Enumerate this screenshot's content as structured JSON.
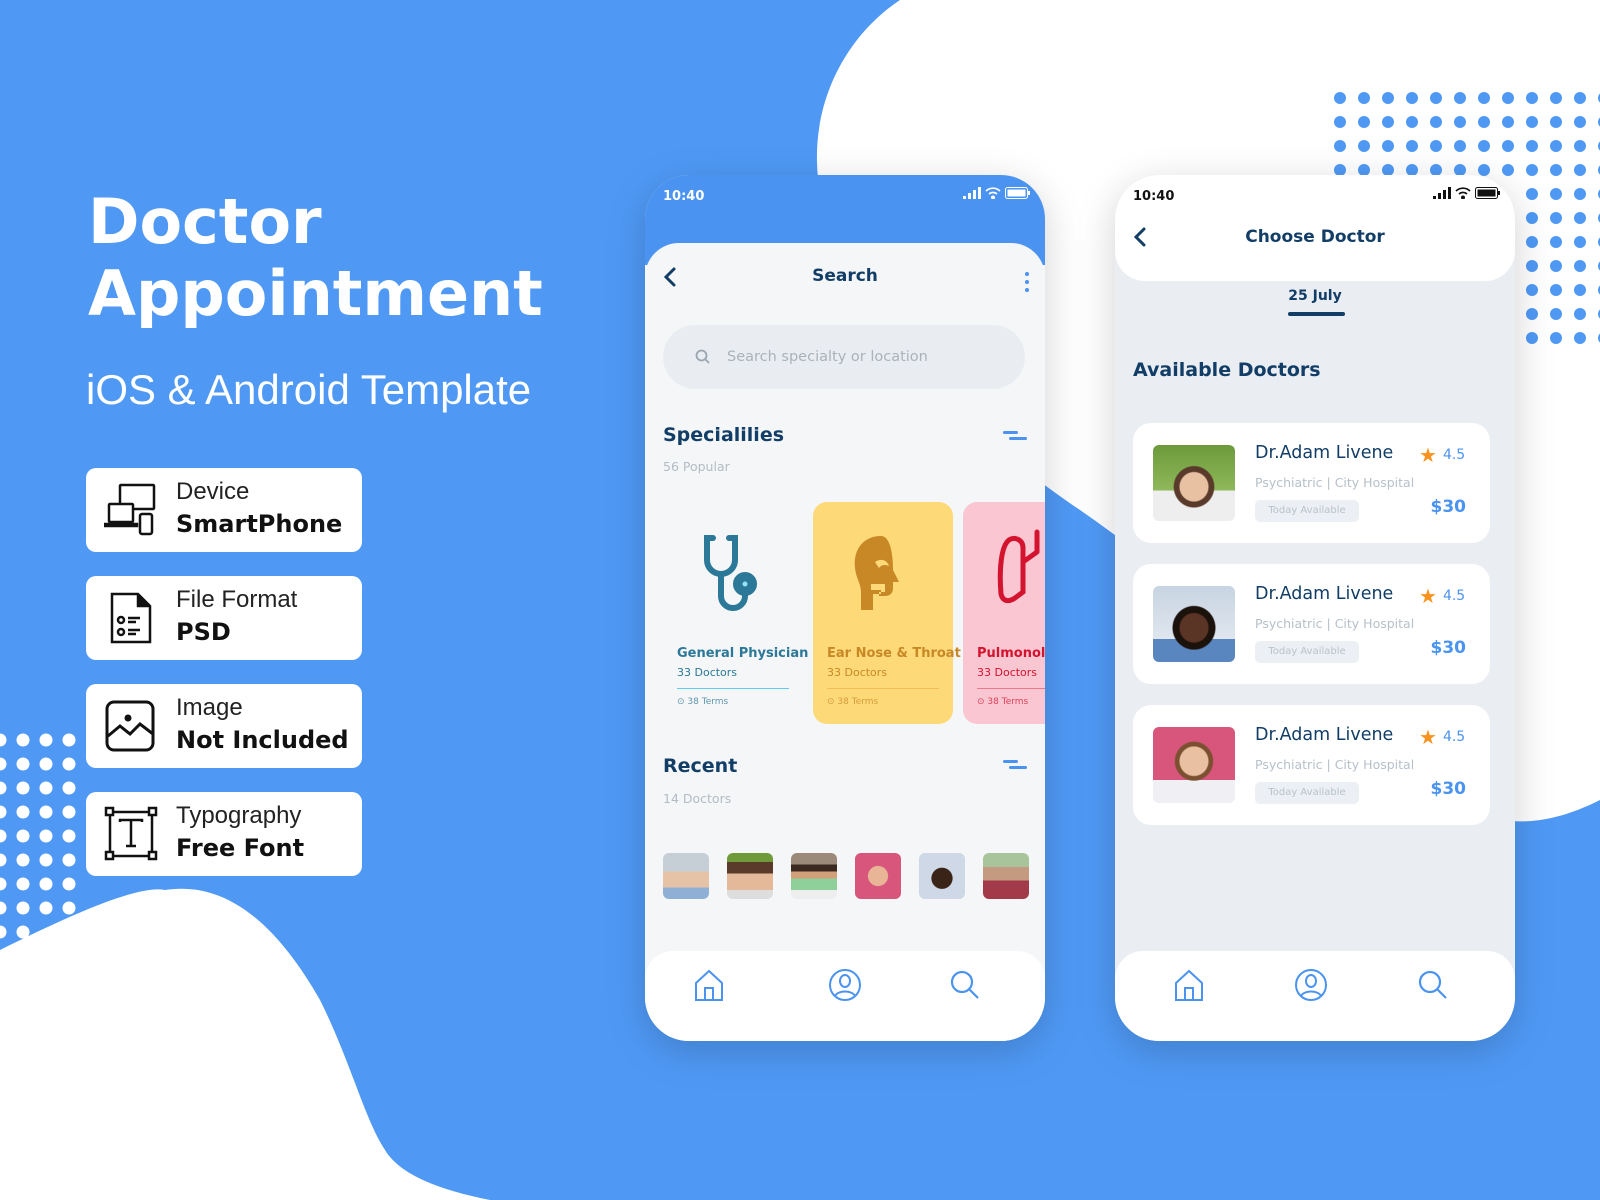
{
  "hero": {
    "title_line1": "Doctor",
    "title_line2": "Appointment",
    "subtitle": "iOS & Android Template"
  },
  "info_cards": [
    {
      "icon": "devices-icon",
      "label": "Device",
      "value": "SmartPhone"
    },
    {
      "icon": "document-list-icon",
      "label": "File Format",
      "value": "PSD"
    },
    {
      "icon": "image-icon",
      "label": "Image",
      "value": "Not Included"
    },
    {
      "icon": "typography-icon",
      "label": "Typography",
      "value": "Free Font"
    }
  ],
  "colors": {
    "brand_blue": "#4f99f5",
    "navy_text": "#113d66",
    "accent_blue": "#4b93f0",
    "star_orange": "#f7931e"
  },
  "phone1": {
    "status_time": "10:40",
    "title": "Search",
    "search_placeholder": "Search specialty or location",
    "specialities": {
      "title": "Specialilies",
      "subtitle": "56 Popular",
      "cards": [
        {
          "icon": "stethoscope-icon",
          "name": "General Physician",
          "count": "33 Doctors",
          "terms": "38 Terms",
          "bg": "#96e1fa",
          "color": "#2b7898"
        },
        {
          "icon": "ent-head-icon",
          "name": "Ear Nose & Throat",
          "count": "33 Doctors",
          "terms": "38 Terms",
          "bg": "#fdd978",
          "color": "#c98826"
        },
        {
          "icon": "lungs-icon",
          "name": "Pulmonology",
          "count": "33 Doctors",
          "terms": "38 Terms",
          "bg": "#f9c6d1",
          "color": "#d4132f"
        }
      ]
    },
    "recent": {
      "title": "Recent",
      "subtitle": "14 Doctors",
      "avatars": [
        "doctor-avatar-1",
        "doctor-avatar-2",
        "doctor-avatar-3",
        "doctor-avatar-4",
        "doctor-avatar-5",
        "doctor-avatar-6"
      ]
    },
    "tabs": [
      "home-icon",
      "profile-icon",
      "search-icon"
    ]
  },
  "phone2": {
    "status_time": "10:40",
    "title": "Choose Doctor",
    "date": "25 July",
    "section_title": "Available Doctors",
    "doctors": [
      {
        "name": "Dr.Adam Livene",
        "rating": "4.5",
        "specialty": "Psychiatric  |  City Hospital",
        "availability": "Today Available",
        "price": "$30"
      },
      {
        "name": "Dr.Adam Livene",
        "rating": "4.5",
        "specialty": "Psychiatric  |  City Hospital",
        "availability": "Today Available",
        "price": "$30"
      },
      {
        "name": "Dr.Adam Livene",
        "rating": "4.5",
        "specialty": "Psychiatric  |  City Hospital",
        "availability": "Today Available",
        "price": "$30"
      }
    ],
    "tabs": [
      "home-icon",
      "profile-icon",
      "search-icon"
    ]
  }
}
